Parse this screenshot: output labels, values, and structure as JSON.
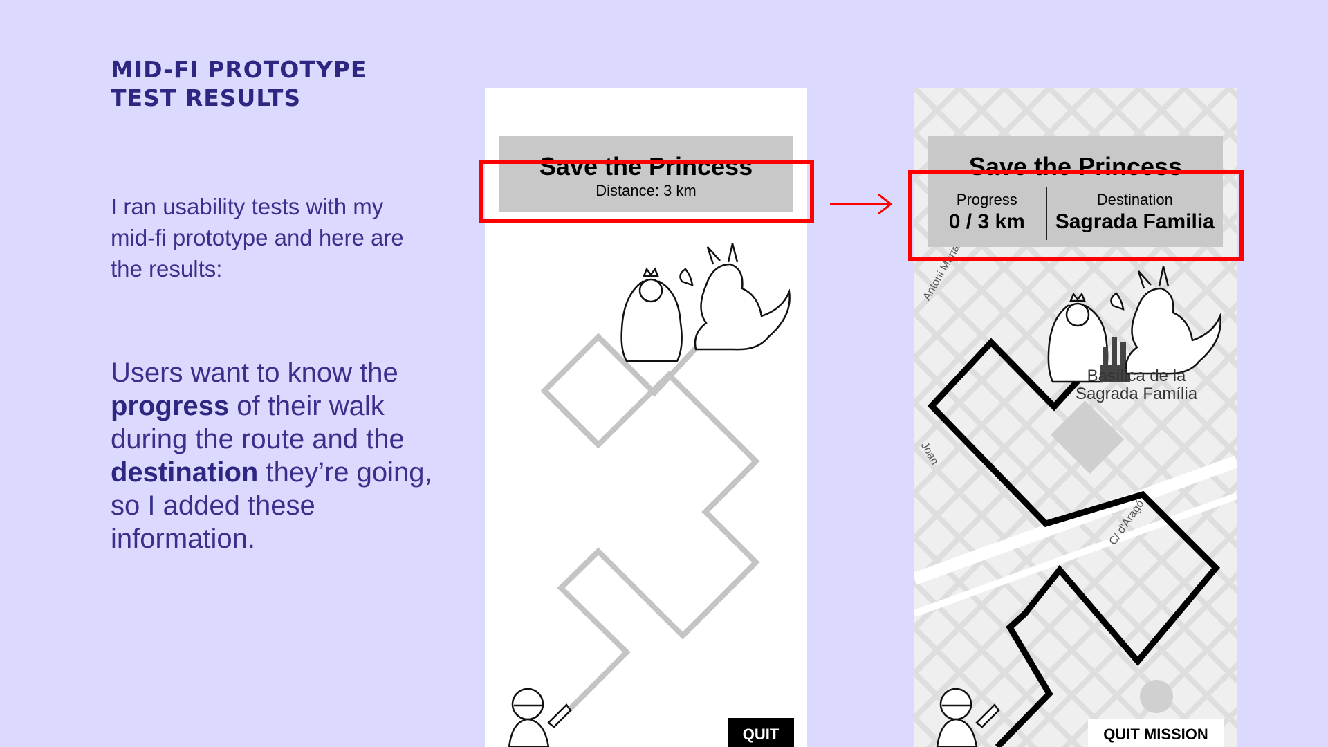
{
  "slide": {
    "heading_line1": "MID-FI PROTOTYPE",
    "heading_line2": "TEST RESULTS",
    "intro": "I ran usability tests with my mid-fi prototype and here are the results:",
    "finding": {
      "part1": "Users want to know the",
      "bold1": "progress",
      "part2": "of their walk during the route and the",
      "bold2": "destination",
      "part3": "they’re going, so I added these information."
    }
  },
  "before_screen": {
    "title": "Save the Princess",
    "distance": "Distance: 3 km",
    "quit_label": "QUIT"
  },
  "after_screen": {
    "title": "Save the Princess",
    "progress_label": "Progress",
    "progress_value": "0 / 3 km",
    "destination_label": "Destination",
    "destination_value": "Sagrada Familia",
    "map_label_line1": "Basílica de la",
    "map_label_line2": "Sagrada Família",
    "streets": [
      "Antoni Maria Cl",
      "Joan",
      "C/ d'Aragó"
    ],
    "quit_label": "QUIT MISSION"
  },
  "colors": {
    "background": "#dcd9fe",
    "text": "#3a2f8a",
    "highlight": "#ff0000",
    "card": "#c8c8c8"
  }
}
